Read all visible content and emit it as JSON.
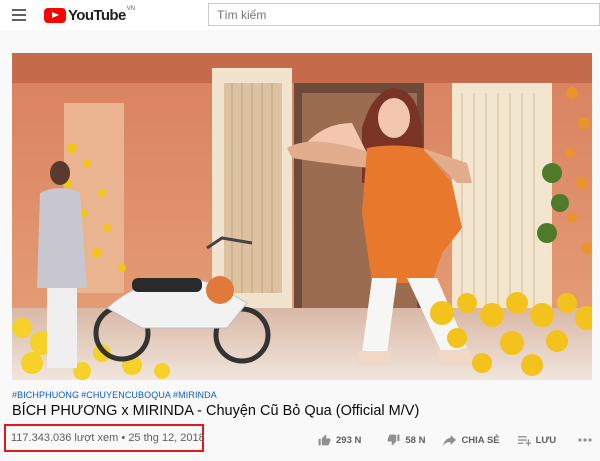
{
  "header": {
    "logo_text": "YouTube",
    "country_code": "VN",
    "search_placeholder": "Tìm kiếm"
  },
  "video": {
    "hashtags": [
      "#BICHPHUONG",
      "#CHUYENCUBOQUA",
      "#MIRINDA"
    ],
    "title": "BÍCH PHƯƠNG x MIRINDA - Chuyện Cũ Bỏ Qua (Official M/V)",
    "views": "117.343.036 lượt xem",
    "separator": "•",
    "date": "25 thg 12, 2018"
  },
  "actions": {
    "likes": "293 N",
    "dislikes": "58 N",
    "share": "CHIA SẺ",
    "save": "LƯU"
  },
  "colors": {
    "highlight": "#e0191c",
    "link": "#065fd4",
    "brand": "#ff0000"
  }
}
